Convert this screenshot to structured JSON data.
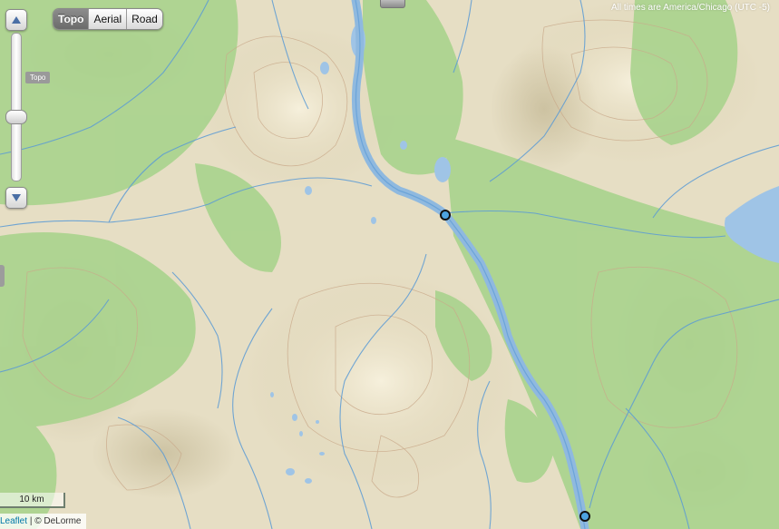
{
  "map": {
    "layers": [
      "Topo",
      "Aerial",
      "Road"
    ],
    "active_layer": "Topo",
    "zoom_label": "Topo",
    "zoom_level_fraction": 0.55,
    "timezone_note": "All times are America/Chicago (UTC -5)",
    "scale_label": "10 km",
    "attribution": {
      "link": "Leaflet",
      "separator": "|",
      "text": "© DeLorme"
    },
    "markers": [
      "waypoint-1",
      "waypoint-2"
    ],
    "colors": {
      "land": "#e8e0c8",
      "forest": "#a9d38d",
      "water": "#9fc4e6",
      "river": "#5b9bd5",
      "contour": "#c9a98a",
      "marker_fill": "#4da3e0"
    }
  }
}
